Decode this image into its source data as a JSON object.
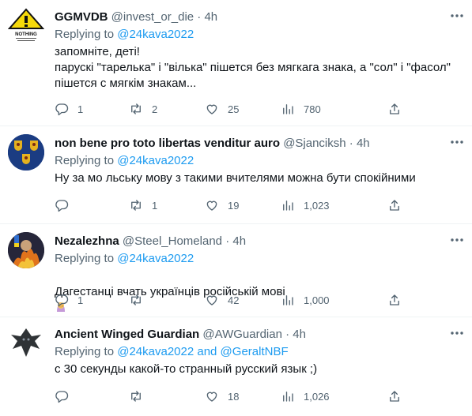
{
  "tweets": [
    {
      "name": "GGMVDB",
      "handle": "@invest_or_die",
      "dot": "·",
      "time": "4h",
      "replying_prefix": "Replying to",
      "replying_to": "@24kava2022",
      "text": "запомніте, деті!\nпарускі \"тарелька\" і \"вілька\" пішется без мягкага знака, а \"сол\" і \"фасол\" пішется с мягкім знакам...",
      "avatar_icon": "nothing-warning-sign-icon",
      "avatar_text": "NOTHING",
      "replies": "1",
      "retweets": "2",
      "likes": "25",
      "views": "780"
    },
    {
      "name": "non bene pro toto libertas venditur auro",
      "handle": "@Sjanciksh",
      "dot": "·",
      "time": "4h",
      "replying_prefix": "Replying to",
      "replying_to": "@24kava2022",
      "text": "Ну за мо  льську мову з такими вчителями можна бути спокійними",
      "avatar_icon": "coat-of-arms-icon",
      "replies": "",
      "retweets": "1",
      "likes": "19",
      "views": "1,023"
    },
    {
      "name": "Nezalezhna",
      "handle": "@Steel_Homeland",
      "dot": "·",
      "time": "4h",
      "replying_prefix": "Replying to",
      "replying_to": "@24kava2022",
      "text": "Дагестанці вчать українців російській мові",
      "emoji": "facepalm-emoji",
      "avatar_icon": "fire-portrait-icon",
      "replies": "1",
      "retweets": "",
      "likes": "42",
      "views": "1,000"
    },
    {
      "name": "Ancient Winged Guardian",
      "handle": "@AWGuardian",
      "dot": "·",
      "time": "4h",
      "replying_prefix": "Replying to",
      "replying_to": "@24kava2022 and @GeraltNBF",
      "text": "с 30 секунды какой-то странный русский язык ;)",
      "avatar_icon": "dragon-icon",
      "replies": "",
      "retweets": "",
      "likes": "18",
      "views": "1,026"
    }
  ]
}
